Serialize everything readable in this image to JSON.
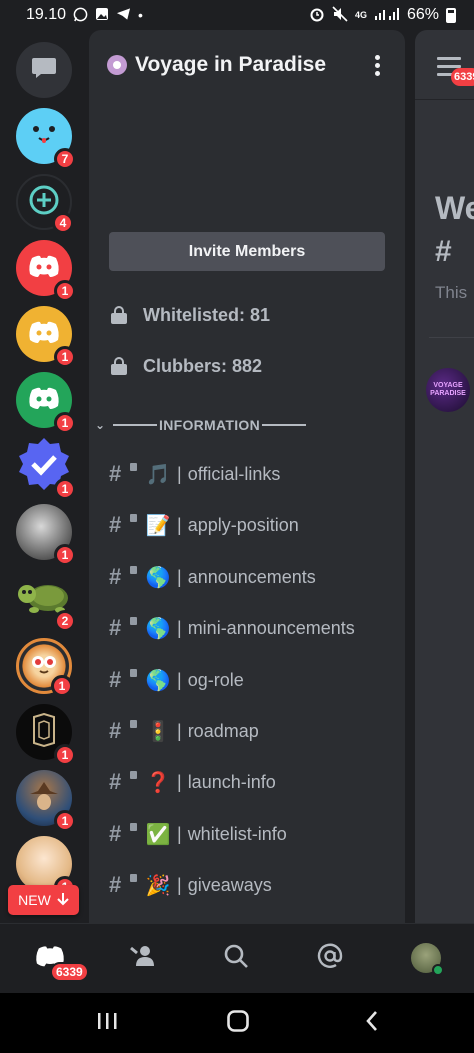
{
  "status_bar": {
    "time": "19.10",
    "left_icons": [
      "whatsapp-icon",
      "gallery-icon",
      "telegram-icon",
      "dot-icon"
    ],
    "right_icons": [
      "alarm-icon",
      "mute-icon",
      "signal-4g-icon",
      "signal-icon"
    ],
    "network": "4G",
    "battery": "66%"
  },
  "server_rail": {
    "servers": [
      {
        "name": "blue-smiley-server",
        "badge": "7",
        "color": "#5dcff5"
      },
      {
        "name": "add-circle-server",
        "badge": "4",
        "color": "#1e1f22"
      },
      {
        "name": "discord-red-server",
        "badge": "1",
        "color": "#f23f43"
      },
      {
        "name": "discord-yellow-server",
        "badge": "1",
        "color": "#f0b232"
      },
      {
        "name": "discord-green-server",
        "badge": "1",
        "color": "#23a55a"
      },
      {
        "name": "verified-blue-server",
        "badge": "1",
        "color": "#5865f2"
      },
      {
        "name": "tiger-server",
        "badge": "1",
        "color": "#8b8b8b"
      },
      {
        "name": "turtle-server",
        "badge": "2",
        "color": "#2b2d31"
      },
      {
        "name": "monkey-server",
        "badge": "1",
        "color": "#f4a259"
      },
      {
        "name": "dark-logo-server",
        "badge": "1",
        "color": "#0b0b0b"
      },
      {
        "name": "wizard-server",
        "badge": "1",
        "color": "#3b5b8a"
      },
      {
        "name": "anime-server",
        "badge": "1",
        "color": "#e9c8a8"
      }
    ],
    "new_label": "NEW"
  },
  "channel_panel": {
    "server_name": "Voyage in Paradise",
    "invite_label": "Invite Members",
    "stats": [
      "Whitelisted: 81",
      "Clubbers: 882"
    ],
    "category": "INFORMATION",
    "channels": [
      {
        "emoji": "🎵",
        "name": "official-links"
      },
      {
        "emoji": "📝",
        "name": "apply-position"
      },
      {
        "emoji": "🌎",
        "name": "announcements"
      },
      {
        "emoji": "🌎",
        "name": "mini-announcements"
      },
      {
        "emoji": "🌎",
        "name": "og-role"
      },
      {
        "emoji": "🚦",
        "name": "roadmap"
      },
      {
        "emoji": "❓",
        "name": "launch-info"
      },
      {
        "emoji": "✅",
        "name": "whitelist-info"
      },
      {
        "emoji": "🎉",
        "name": "giveaways"
      }
    ]
  },
  "chat_peek": {
    "badge": "6339",
    "title": "We",
    "hash": "#",
    "subtitle": "This",
    "avatar_text": "VOYAGE PARADISE"
  },
  "tab_bar": {
    "home_badge": "6339",
    "tabs": [
      "home-tab",
      "friends-tab",
      "search-tab",
      "mentions-tab",
      "profile-tab"
    ]
  },
  "colors": {
    "background": "#1e1f22",
    "panel": "#2b2d31",
    "badge": "#f23f43",
    "online": "#23a55a"
  }
}
